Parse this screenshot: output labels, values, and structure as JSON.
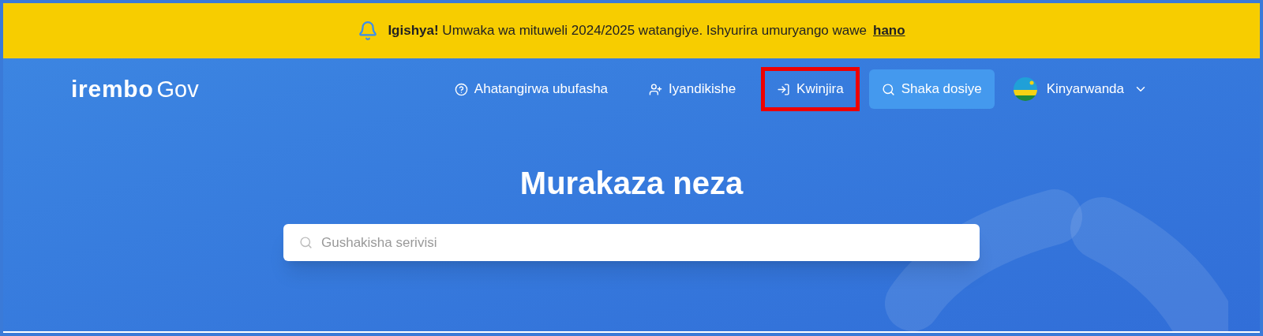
{
  "banner": {
    "text": "**Igishya!** Umwaka wa mituweli 2024/2025 watangiye. Ishyurira umuryango wawe",
    "link": "hano"
  },
  "logo": {
    "brand": "irembo",
    "suffix": "Gov"
  },
  "nav": [
    {
      "kind": "help",
      "label": "Ahatangirwa ubufasha",
      "highlighted": false
    },
    {
      "kind": "register",
      "label": "Iyandikishe",
      "highlighted": false
    },
    {
      "kind": "login",
      "label": "Kwinjira",
      "highlighted": true
    },
    {
      "kind": "search",
      "label": "Shaka dosiye",
      "highlighted": false
    },
    {
      "kind": "language",
      "label": "Kinyarwanda",
      "highlighted": false
    }
  ],
  "hero": {
    "title": "Murakaza neza",
    "search": {
      "placeholder": "Gushakisha serivisi"
    }
  }
}
